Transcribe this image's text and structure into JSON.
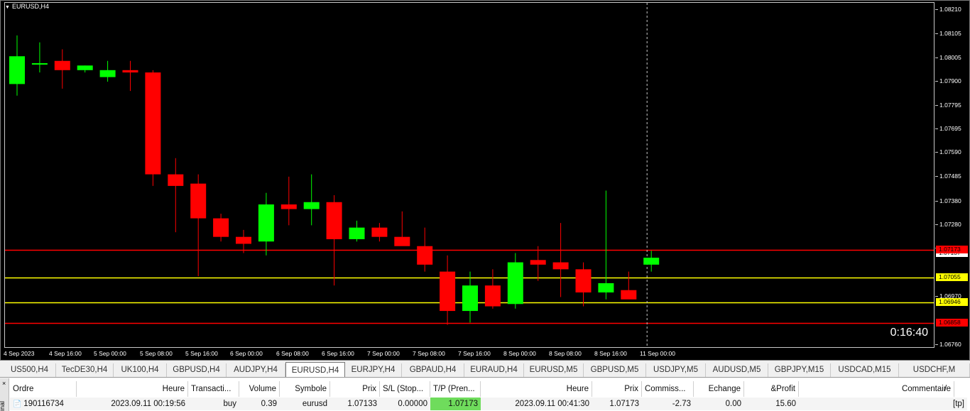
{
  "chart": {
    "title": "EURUSD,H4",
    "countdown": "0:16:40",
    "bg_color": "#000000",
    "bull_color": "#00ff00",
    "bear_color": "#ff0000",
    "price_ticks": [
      "1.08210",
      "1.08105",
      "1.08005",
      "1.07900",
      "1.07795",
      "1.07695",
      "1.07590",
      "1.07485",
      "1.07380",
      "1.07280",
      "1.07175",
      "1.06970",
      "1.06760"
    ],
    "time_labels": [
      "4 Sep 2023",
      "4 Sep 16:00",
      "5 Sep 00:00",
      "5 Sep 08:00",
      "5 Sep 16:00",
      "6 Sep 00:00",
      "6 Sep 08:00",
      "6 Sep 16:00",
      "7 Sep 00:00",
      "7 Sep 08:00",
      "7 Sep 16:00",
      "8 Sep 00:00",
      "8 Sep 08:00",
      "8 Sep 16:00",
      "11 Sep 00:00"
    ],
    "levels": [
      {
        "price": 1.07173,
        "label": "1.07173",
        "color": "#ff0000",
        "label_bg": "#ff0000",
        "label_fg": "#000000"
      },
      {
        "price": 1.07055,
        "label": "1.07055",
        "color": "#ffff00",
        "label_bg": "#ffff00",
        "label_fg": "#000000"
      },
      {
        "price": 1.06946,
        "label": "1.06946",
        "color": "#ffff00",
        "label_bg": "#ffff00",
        "label_fg": "#000000"
      },
      {
        "price": 1.06858,
        "label": "1.06858",
        "color": "#ff0000",
        "label_bg": "#ff0000",
        "label_fg": "#000000"
      }
    ],
    "current_price_label": "1.07137",
    "current_time_marker": "11 Sep 00:00"
  },
  "chart_data": {
    "type": "candlestick",
    "title": "EURUSD,H4",
    "ylim": [
      1.0674,
      1.0823
    ],
    "candles": [
      {
        "o": 1.0789,
        "h": 1.081,
        "l": 1.0784,
        "c": 1.0801
      },
      {
        "o": 1.0798,
        "h": 1.0807,
        "l": 1.0794,
        "c": 1.0798
      },
      {
        "o": 1.0799,
        "h": 1.0804,
        "l": 1.0787,
        "c": 1.0795
      },
      {
        "o": 1.0795,
        "h": 1.0797,
        "l": 1.0794,
        "c": 1.0797
      },
      {
        "o": 1.0792,
        "h": 1.0799,
        "l": 1.079,
        "c": 1.0795
      },
      {
        "o": 1.0795,
        "h": 1.0799,
        "l": 1.0786,
        "c": 1.0794
      },
      {
        "o": 1.0794,
        "h": 1.0795,
        "l": 1.0745,
        "c": 1.075
      },
      {
        "o": 1.075,
        "h": 1.0757,
        "l": 1.0725,
        "c": 1.0745
      },
      {
        "o": 1.0746,
        "h": 1.075,
        "l": 1.0706,
        "c": 1.0731
      },
      {
        "o": 1.0731,
        "h": 1.0733,
        "l": 1.0721,
        "c": 1.0723
      },
      {
        "o": 1.0723,
        "h": 1.0726,
        "l": 1.0716,
        "c": 1.072
      },
      {
        "o": 1.0721,
        "h": 1.0742,
        "l": 1.0715,
        "c": 1.0737
      },
      {
        "o": 1.0737,
        "h": 1.0749,
        "l": 1.0728,
        "c": 1.0735
      },
      {
        "o": 1.0735,
        "h": 1.075,
        "l": 1.0728,
        "c": 1.0738
      },
      {
        "o": 1.0738,
        "h": 1.0741,
        "l": 1.0702,
        "c": 1.0722
      },
      {
        "o": 1.0722,
        "h": 1.073,
        "l": 1.0721,
        "c": 1.0727
      },
      {
        "o": 1.0727,
        "h": 1.0729,
        "l": 1.0721,
        "c": 1.0723
      },
      {
        "o": 1.0723,
        "h": 1.0734,
        "l": 1.072,
        "c": 1.0719
      },
      {
        "o": 1.0719,
        "h": 1.0727,
        "l": 1.0708,
        "c": 1.0711
      },
      {
        "o": 1.0708,
        "h": 1.0715,
        "l": 1.0685,
        "c": 1.0691
      },
      {
        "o": 1.0691,
        "h": 1.0708,
        "l": 1.0686,
        "c": 1.0702
      },
      {
        "o": 1.0702,
        "h": 1.0709,
        "l": 1.0692,
        "c": 1.0693
      },
      {
        "o": 1.0694,
        "h": 1.0716,
        "l": 1.0692,
        "c": 1.0712
      },
      {
        "o": 1.0713,
        "h": 1.0719,
        "l": 1.0704,
        "c": 1.0711
      },
      {
        "o": 1.0712,
        "h": 1.0729,
        "l": 1.0697,
        "c": 1.0709
      },
      {
        "o": 1.0709,
        "h": 1.0712,
        "l": 1.0693,
        "c": 1.0699
      },
      {
        "o": 1.0699,
        "h": 1.0743,
        "l": 1.0696,
        "c": 1.0703
      },
      {
        "o": 1.07,
        "h": 1.0708,
        "l": 1.0698,
        "c": 1.0696
      },
      {
        "o": 1.0711,
        "h": 1.0717,
        "l": 1.0708,
        "c": 1.0714
      }
    ]
  },
  "symbol_tabs": [
    "US500,H4",
    "TecDE30,H4",
    "UK100,H4",
    "GBPUSD,H4",
    "AUDJPY,H4",
    "EURUSD,H4",
    "EURJPY,H4",
    "GBPAUD,H4",
    "EURAUD,H4",
    "EURUSD,M5",
    "GBPUSD,M5",
    "USDJPY,M5",
    "AUDUSD,M5",
    "GBPJPY,M15",
    "USDCAD,M15",
    "USDCHF,M"
  ],
  "active_tab_index": 5,
  "terminal": {
    "side_label": "inal",
    "close_glyph": "×",
    "headers": [
      "Ordre",
      "Heure",
      "Transacti...",
      "Volume",
      "Symbole",
      "Prix",
      "S/L (Stop...",
      "T/P (Pren...",
      "Heure",
      "Prix",
      "Commiss...",
      "Echange",
      "&Profit",
      "Commentaire"
    ],
    "sort_marker": "/",
    "row": {
      "ordre": "190116734",
      "heure": "2023.09.11 00:19:56",
      "transaction": "buy",
      "volume": "0.39",
      "symbole": "eurusd",
      "prix": "1.07133",
      "sl": "0.00000",
      "tp": "1.07173",
      "heure2": "2023.09.11 00:41:30",
      "prix2": "1.07173",
      "commission": "-2.73",
      "echange": "0.00",
      "profit": "15.60",
      "commentaire": "[tp]"
    }
  }
}
